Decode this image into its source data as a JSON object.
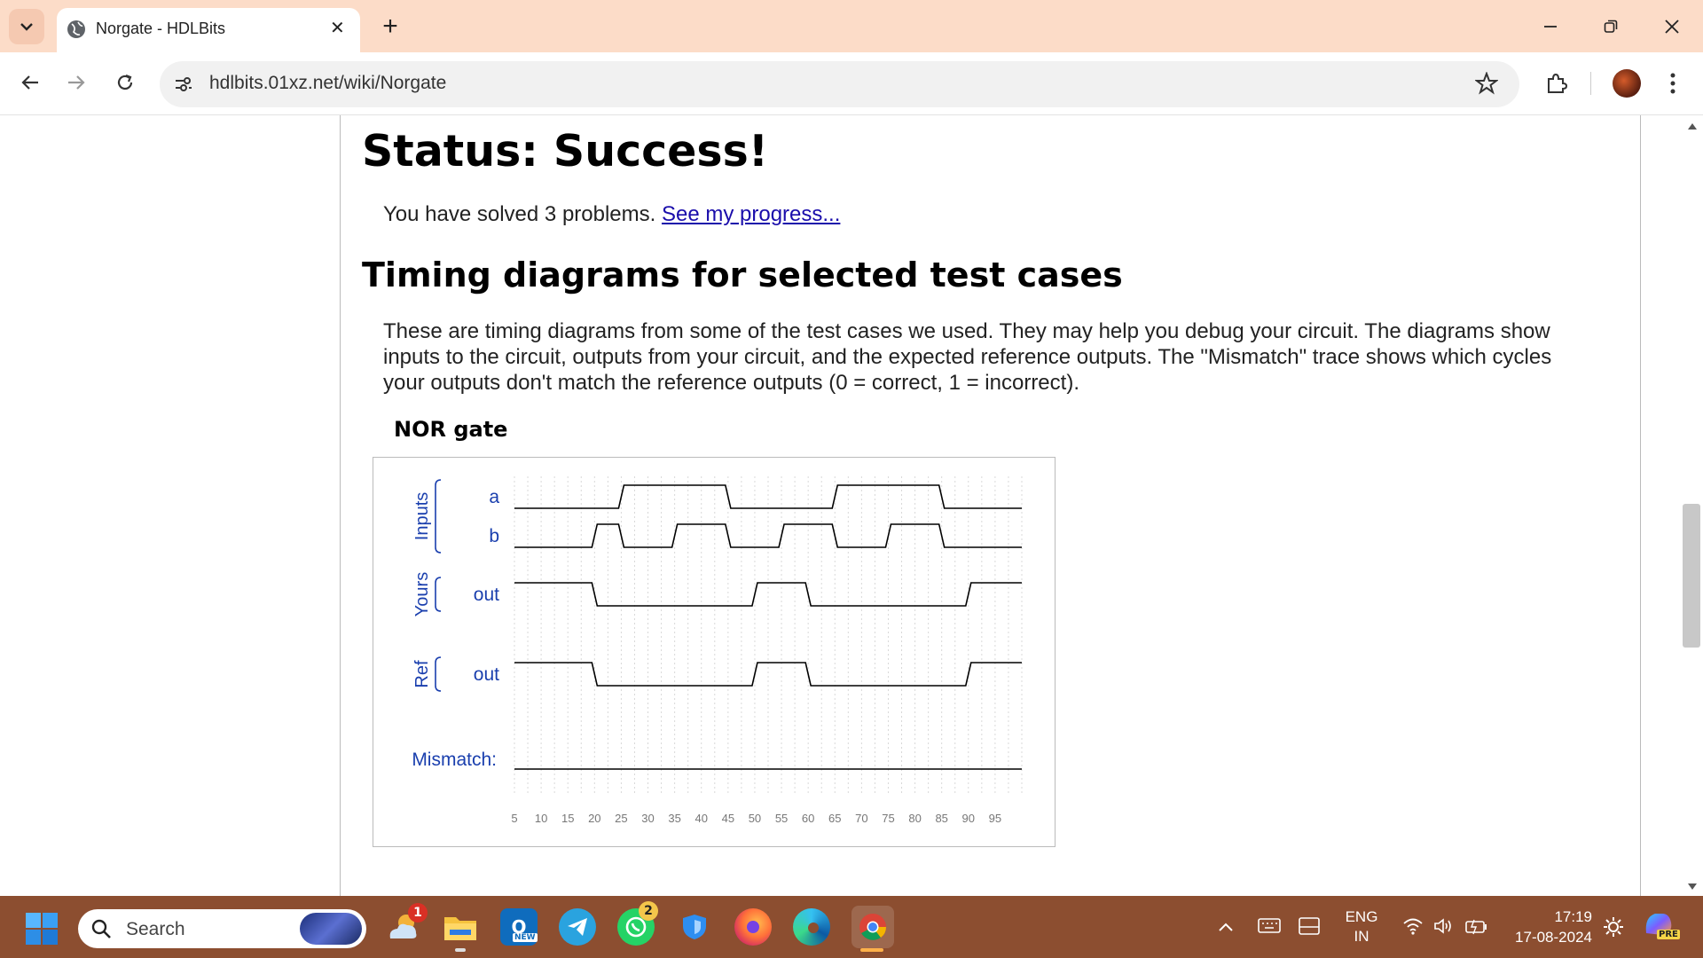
{
  "browser": {
    "tab_title": "Norgate - HDLBits",
    "url": "hdlbits.01xz.net/wiki/Norgate",
    "new_tab_glyph": "+",
    "close_glyph": "✕"
  },
  "page": {
    "status_heading": "Status: Success!",
    "solved_text": "You have solved 3 problems.",
    "progress_link": "See my progress...",
    "timing_heading": "Timing diagrams for selected test cases",
    "timing_paragraph": [
      "These are timing diagrams from some of the test cases we used. They may help you debug your circuit. The diagrams show",
      "inputs to the circuit, outputs from your circuit, and the expected reference outputs. The \"Mismatch\" trace shows which cycles",
      "your outputs don't match the reference outputs (0 = correct, 1 = incorrect)."
    ],
    "diagram_title": "NOR gate"
  },
  "chart_data": {
    "type": "timing",
    "x_ticks": [
      5,
      10,
      15,
      20,
      25,
      30,
      35,
      40,
      45,
      50,
      55,
      60,
      65,
      70,
      75,
      80,
      85,
      90,
      95
    ],
    "xlim": [
      5,
      100
    ],
    "groups": [
      {
        "label": "Inputs",
        "signals": [
          "a",
          "b"
        ]
      },
      {
        "label": "Yours",
        "signals": [
          "yours_out"
        ]
      },
      {
        "label": "Ref",
        "signals": [
          "ref_out"
        ]
      }
    ],
    "signals": [
      {
        "id": "a",
        "name": "a",
        "initial": 0,
        "transitions": [
          25,
          45,
          65,
          85
        ]
      },
      {
        "id": "b",
        "name": "b",
        "initial": 0,
        "transitions": [
          20,
          25,
          35,
          45,
          55,
          65,
          75,
          85
        ]
      },
      {
        "id": "yours_out",
        "name": "out",
        "initial": 1,
        "transitions": [
          20,
          50,
          60,
          90
        ]
      },
      {
        "id": "ref_out",
        "name": "out",
        "initial": 1,
        "transitions": [
          20,
          50,
          60,
          90
        ]
      },
      {
        "id": "mismatch",
        "name": "Mismatch:",
        "initial": 0,
        "transitions": []
      }
    ]
  },
  "taskbar": {
    "search_placeholder": "Search",
    "weather_badge": "1",
    "whatsapp_badge": "2",
    "outlook_label": "NEW",
    "lang_top": "ENG",
    "lang_bottom": "IN",
    "time": "17:19",
    "date": "17-08-2024",
    "copilot_label": "PRE"
  },
  "colors": {
    "tabbar_bg": "#fcdcc8",
    "taskbar_bg": "#8c4e30",
    "link": "#1a0dab",
    "diagram_label": "#1a3fae"
  }
}
